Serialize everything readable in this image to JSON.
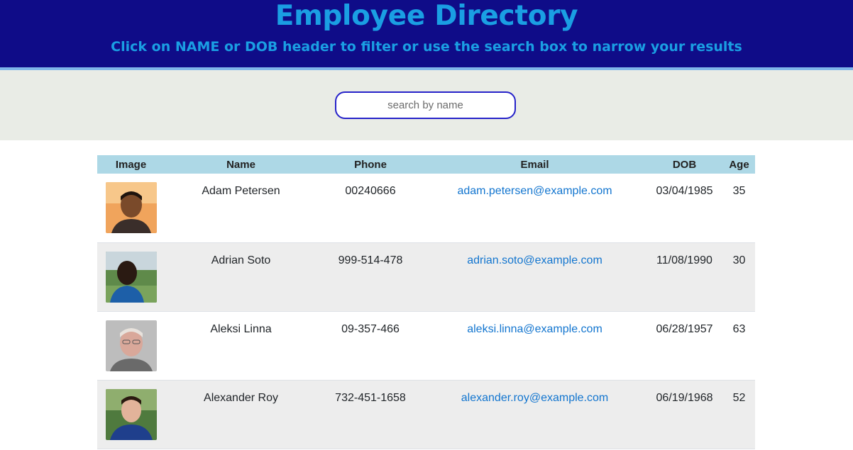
{
  "header": {
    "title": "Employee Directory",
    "subtitle": "Click on NAME or DOB header to filter or use the search box to narrow your results"
  },
  "search": {
    "placeholder": "search by name",
    "value": ""
  },
  "table": {
    "columns": [
      "Image",
      "Name",
      "Phone",
      "Email",
      "DOB",
      "Age"
    ],
    "rows": [
      {
        "name": "Adam Petersen",
        "phone": "00240666",
        "email": "adam.petersen@example.com",
        "dob": "03/04/1985",
        "age": "35"
      },
      {
        "name": "Adrian Soto",
        "phone": "999-514-478",
        "email": "adrian.soto@example.com",
        "dob": "11/08/1990",
        "age": "30"
      },
      {
        "name": "Aleksi Linna",
        "phone": "09-357-466",
        "email": "aleksi.linna@example.com",
        "dob": "06/28/1957",
        "age": "63"
      },
      {
        "name": "Alexander Roy",
        "phone": "732-451-1658",
        "email": "alexander.roy@example.com",
        "dob": "06/19/1968",
        "age": "52"
      }
    ]
  },
  "colors": {
    "header_bg": "#0f0c88",
    "title": "#1a9fe3",
    "table_header_bg": "#add8e6",
    "link": "#1275cf"
  }
}
